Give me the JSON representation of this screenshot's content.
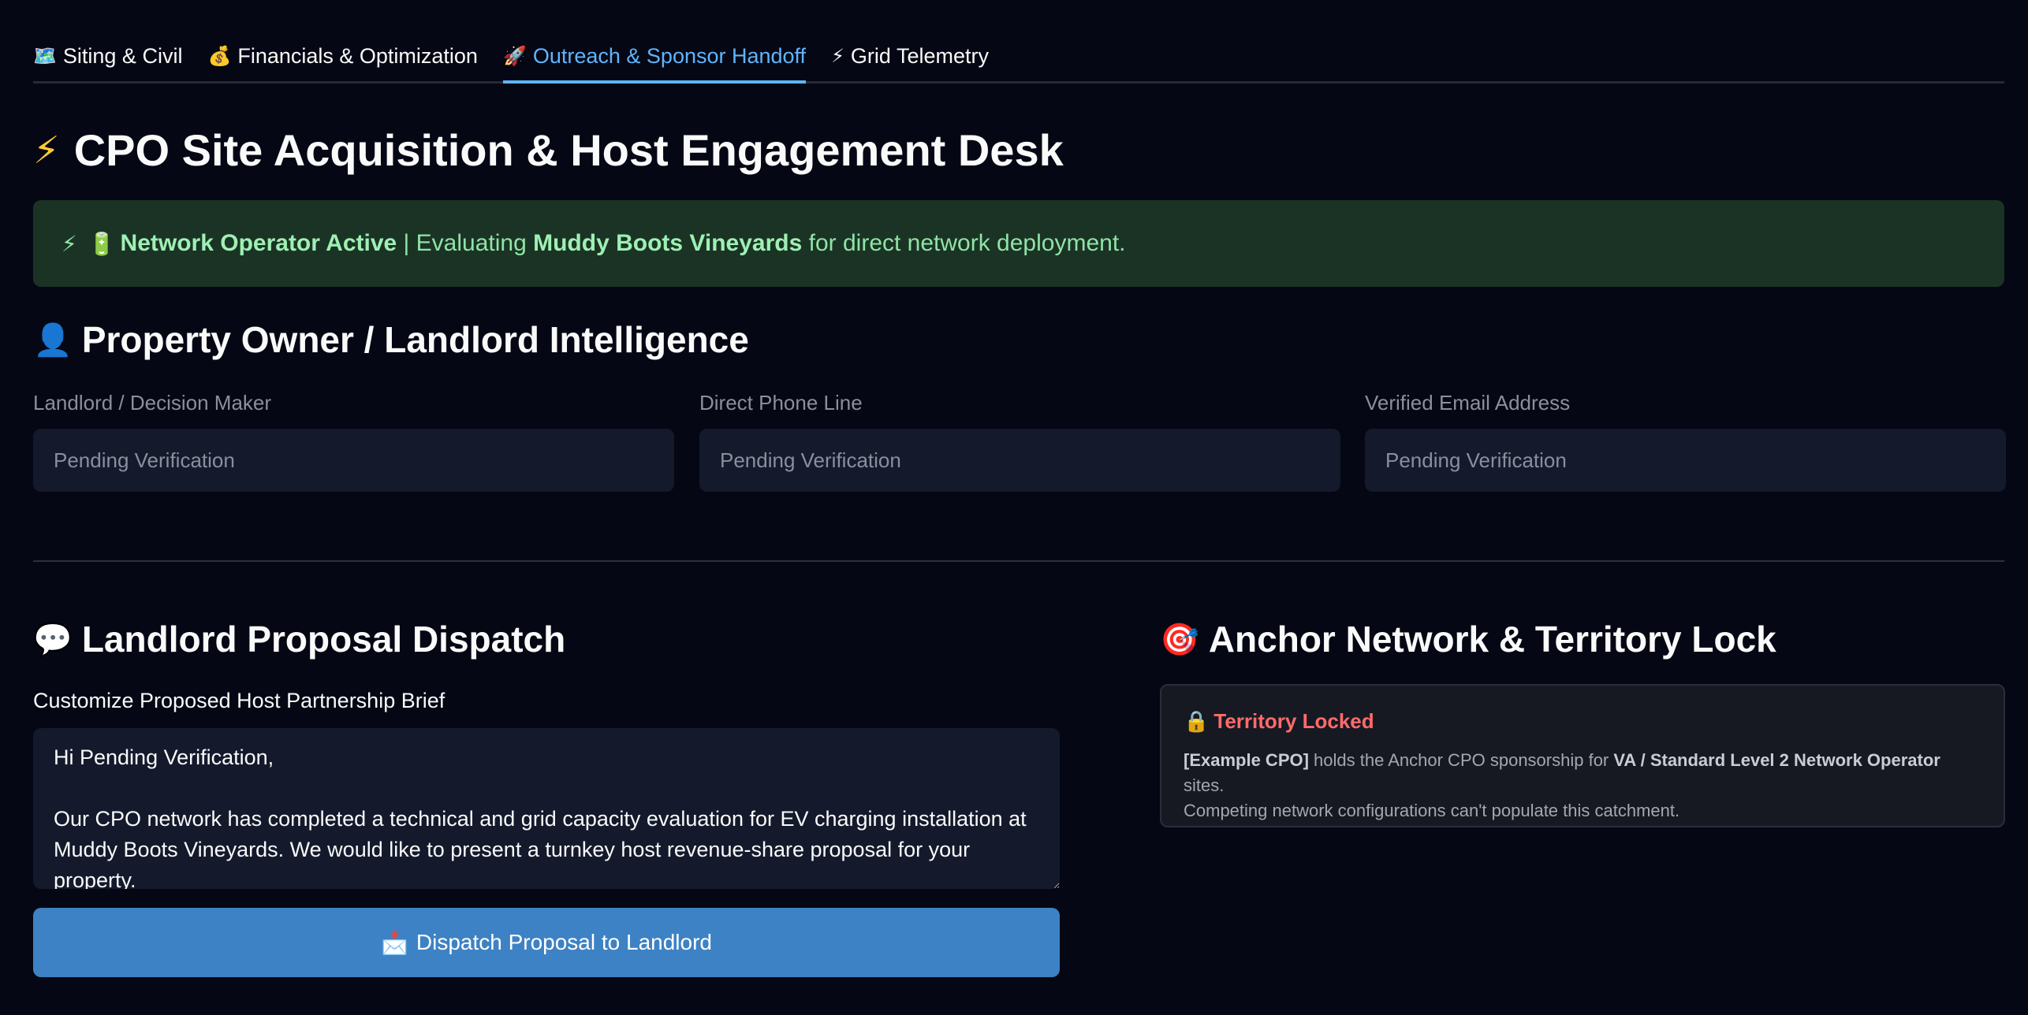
{
  "tabs": [
    {
      "icon": "🗺️",
      "label": "Siting & Civil"
    },
    {
      "icon": "💰",
      "label": "Financials & Optimization"
    },
    {
      "icon": "🚀",
      "label": "Outreach & Sponsor Handoff"
    },
    {
      "icon": "⚡",
      "label": "Grid Telemetry"
    }
  ],
  "page": {
    "title_icon": "⚡",
    "title": "CPO Site Acquisition & Host Engagement Desk"
  },
  "alert": {
    "icon1": "⚡",
    "icon2": "🔋",
    "status": "Network Operator Active",
    "sep": " | Evaluating ",
    "site": "Muddy Boots Vineyards",
    "suffix": " for direct network deployment."
  },
  "owner_section": {
    "icon": "👤",
    "title": "Property Owner / Landlord Intelligence",
    "fields": [
      {
        "label": "Landlord / Decision Maker",
        "placeholder": "Pending Verification"
      },
      {
        "label": "Direct Phone Line",
        "placeholder": "Pending Verification"
      },
      {
        "label": "Verified Email Address",
        "placeholder": "Pending Verification"
      }
    ]
  },
  "proposal": {
    "icon": "💬",
    "title": "Landlord Proposal Dispatch",
    "label": "Customize Proposed Host Partnership Brief",
    "body": "Hi Pending Verification,\n\nOur CPO network has completed a technical and grid capacity evaluation for EV charging installation at Muddy Boots Vineyards. We would like to present a turnkey host revenue-share proposal for your property.",
    "button_icon": "📩",
    "button_label": "Dispatch Proposal to Landlord"
  },
  "territory": {
    "icon": "🎯",
    "title": "Anchor Network & Territory Lock",
    "lock_icon": "🔒",
    "lock_title": "Territory Locked",
    "sponsor": "[Example CPO]",
    "text1": " holds the Anchor CPO sponsorship for ",
    "tier": "VA / Standard Level 2 Network Operator",
    "text2": " sites.",
    "text3": "Competing network configurations can't populate this catchment."
  },
  "colors": {
    "background": "#050814",
    "accent": "#60b4ff",
    "success_bg": "#1b3325",
    "button": "#3d82c4",
    "locked": "#ff6b6b"
  }
}
